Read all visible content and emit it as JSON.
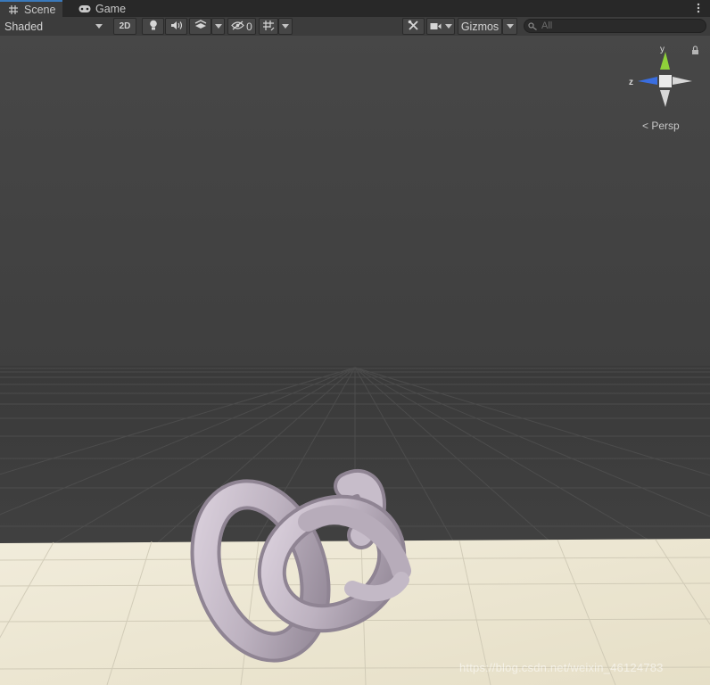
{
  "tabs": [
    {
      "label": "Scene",
      "icon": "grid-icon",
      "active": true
    },
    {
      "label": "Game",
      "icon": "gamepad-icon",
      "active": false
    }
  ],
  "toolbar": {
    "shading_mode": "Shaded",
    "mode_2d": "2D",
    "hidden_count": "0",
    "gizmos_label": "Gizmos",
    "search_placeholder": "All"
  },
  "scene_gizmo": {
    "y_label": "y",
    "z_label": "z",
    "projection_label": "Persp"
  },
  "watermark": "https://blog.csdn.net/weixin_46124783",
  "colors": {
    "sky": "#474747",
    "horizon": "#3a3a3a",
    "ground_plane": "#ece6d2",
    "torus_knot": "#c9bfcb",
    "tab_active_accent": "#3a79bb",
    "axis_y": "#8fd13a",
    "axis_z": "#3a6ee0"
  }
}
